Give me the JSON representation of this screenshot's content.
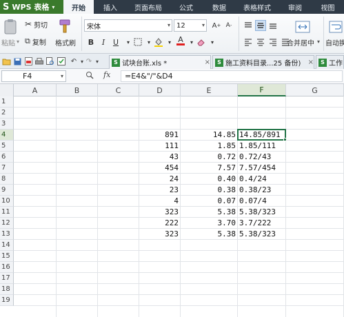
{
  "app": {
    "logo_text": "WPS 表格",
    "menu_tabs": [
      "开始",
      "插入",
      "页面布局",
      "公式",
      "数据",
      "表格样式",
      "审阅",
      "视图"
    ],
    "active_tab": "开始"
  },
  "ribbon": {
    "paste_label": "粘贴",
    "cut_label": "剪切",
    "copy_label": "复制",
    "format_painter_label": "格式刷",
    "font_name": "宋体",
    "font_size": "12",
    "bold": "B",
    "italic": "I",
    "underline": "U",
    "merge_center_label": "合并居中",
    "autowrap_label": "自动换"
  },
  "doc_tabs": [
    {
      "label": "试块台账.xls *",
      "icon": "excel-file-icon"
    },
    {
      "label": "施工资料目录...25 备份)",
      "icon": "excel-file-icon"
    },
    {
      "label": "工作",
      "icon": "excel-file-icon"
    }
  ],
  "formula_bar": {
    "name_box": "F4",
    "fx": "fx",
    "formula": "=E4&\"/\"&D4"
  },
  "sheet": {
    "columns": [
      "A",
      "B",
      "C",
      "D",
      "E",
      "F",
      "G"
    ],
    "active_column": "F",
    "active_row": 4,
    "row_numbers": [
      "1",
      "2",
      "3",
      "4",
      "5",
      "6",
      "7",
      "8",
      "9",
      "10",
      "11",
      "12",
      "13",
      "14",
      "15",
      "16",
      "17",
      "18",
      "19"
    ],
    "data_rows": [
      {
        "row": 4,
        "D": "891",
        "E": "14.85",
        "F": "14.85/891"
      },
      {
        "row": 5,
        "D": "111",
        "E": "1.85",
        "F": "1.85/111"
      },
      {
        "row": 6,
        "D": "43",
        "E": "0.72",
        "F": "0.72/43"
      },
      {
        "row": 7,
        "D": "454",
        "E": "7.57",
        "F": "7.57/454"
      },
      {
        "row": 8,
        "D": "24",
        "E": "0.40",
        "F": "0.4/24"
      },
      {
        "row": 9,
        "D": "23",
        "E": "0.38",
        "F": "0.38/23"
      },
      {
        "row": 10,
        "D": "4",
        "E": "0.07",
        "F": "0.07/4"
      },
      {
        "row": 11,
        "D": "323",
        "E": "5.38",
        "F": "5.38/323"
      },
      {
        "row": 12,
        "D": "222",
        "E": "3.70",
        "F": "3.7/222"
      },
      {
        "row": 13,
        "D": "323",
        "E": "5.38",
        "F": "5.38/323"
      }
    ]
  },
  "colors": {
    "menu_bg": "#2f3a46",
    "logo_bg": "#3a7a2c",
    "selection": "#217346"
  }
}
